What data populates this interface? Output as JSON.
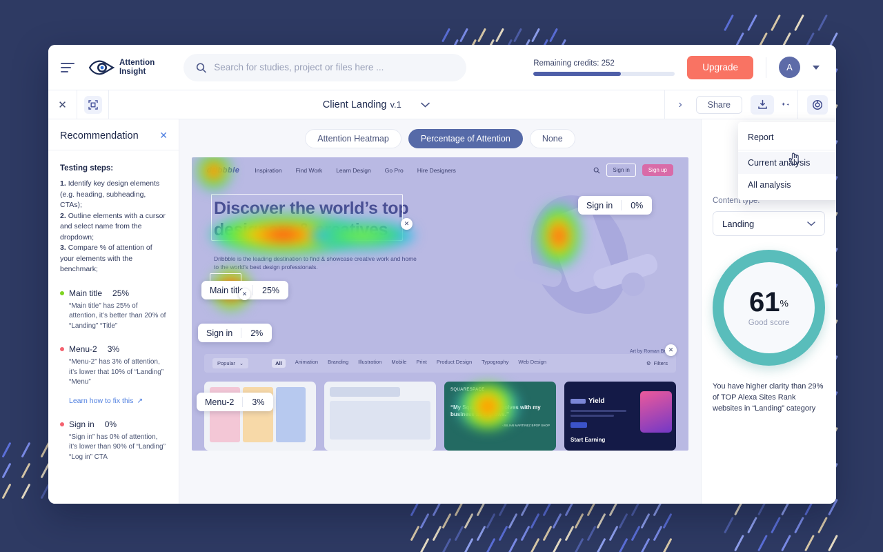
{
  "app": {
    "brand_line1": "Attention",
    "brand_line2": "Insight"
  },
  "search": {
    "placeholder": "Search for studies, project or files here ...",
    "value": "",
    "icon": "search-icon"
  },
  "header": {
    "credits_label": "Remaining credits: 252",
    "credits_percent": 62,
    "upgrade_label": "Upgrade",
    "avatar_initial": "A"
  },
  "toolbar": {
    "close_label": "✕",
    "project_name": "Client Landing",
    "project_version": "v.1",
    "share_label": "Share",
    "next_label": "›"
  },
  "menu": {
    "title": "Report",
    "items": [
      {
        "label": "Current analysis",
        "hovered": true
      },
      {
        "label": "All analysis",
        "hovered": false
      }
    ]
  },
  "recommendation": {
    "title": "Recommendation",
    "close_label": "✕",
    "steps_title": "Testing steps:",
    "steps": [
      {
        "num": "1.",
        "text": "Identify key design elements (e.g. heading, subheading, CTAs);"
      },
      {
        "num": "2.",
        "text": "Outline elements with a cursor and select name from the dropdown;"
      },
      {
        "num": "3.",
        "text": "Compare % of attention of your elements with the benchmark;"
      }
    ],
    "items": [
      {
        "name": "Main title",
        "percent": "25%",
        "dot_color": "#7ed321",
        "description": "“Main title” has 25% of attention, it’s better than 20% of “Landing” “Title”"
      },
      {
        "name": "Menu-2",
        "percent": "3%",
        "dot_color": "#f4626f",
        "description": "“Menu-2” has 3% of attention, it’s lower that 10% of “Landing” “Menu”",
        "link": "Learn how to fix this"
      },
      {
        "name": "Sign in",
        "percent": "0%",
        "dot_color": "#f4626f",
        "description": "“Sign in” has 0% of attention, it’s lower than 90% of “Landing” “Log in” CTA"
      }
    ]
  },
  "canvas": {
    "modes": [
      {
        "label": "Attention Heatmap",
        "active": false
      },
      {
        "label": "Percentage of Attention",
        "active": true
      },
      {
        "label": "None",
        "active": false
      }
    ],
    "annotations": [
      {
        "name": "Sign in",
        "value": "0%"
      },
      {
        "name": "Main title",
        "value": "25%"
      },
      {
        "name": "Sign in",
        "value": "2%"
      },
      {
        "name": "Menu-2",
        "value": "3%"
      }
    ]
  },
  "preview_site": {
    "logo": "dribbble",
    "nav": [
      "Inspiration",
      "Find Work",
      "Learn Design",
      "Go Pro",
      "Hire Designers"
    ],
    "signin": "Sign in",
    "signup": "Sign up",
    "hero_title": "Discover the world’s top designers & creatives",
    "hero_subtitle": "Dribbble is the leading destination to find & showcase creative work and home to the world’s best design professionals.",
    "art_credit": "Art by Roman Braux",
    "sort_label": "Popular",
    "categories": [
      "All",
      "Animation",
      "Branding",
      "Illustration",
      "Mobile",
      "Print",
      "Product Design",
      "Typography",
      "Web Design"
    ],
    "active_category": "All",
    "filters_label": "Filters",
    "card2_quote": "“My Squarespace evolves with my business as it grows.”",
    "card2_brand": "SQUARESPACE",
    "card2_author": "-JULIAN MARTINEZ BPOP SHOP",
    "card3_title": "Yield",
    "card3_cta": "Start Earning"
  },
  "right_panel": {
    "close_label": "✕",
    "content_type_label": "Content type:",
    "content_type_value": "Landing",
    "score_value": "61",
    "score_unit": "%",
    "score_caption": "Good score",
    "score_color": "#59bdbb",
    "clarity_text": "You have higher clarity than 29% of TOP Alexa Sites Rank websites in “Landing” category"
  }
}
